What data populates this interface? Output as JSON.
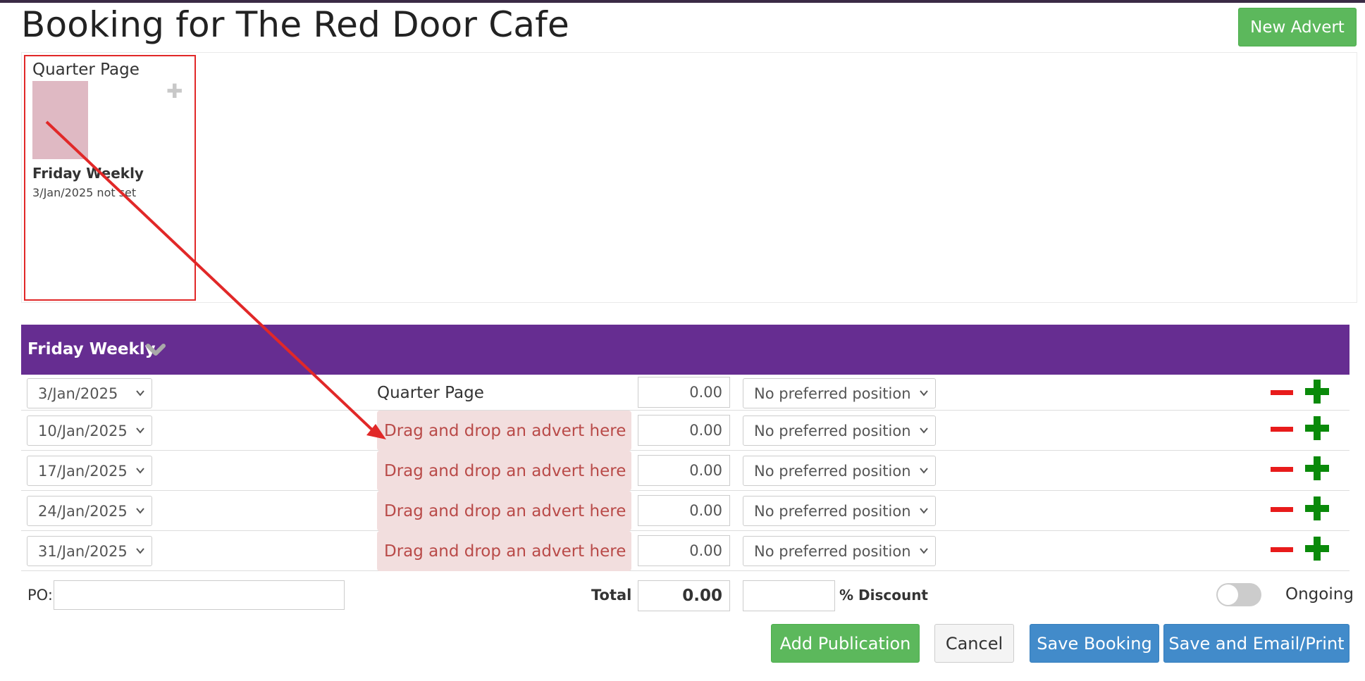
{
  "page": {
    "title": "Booking for The Red Door Cafe",
    "new_advert_label": "New Advert"
  },
  "advert_card": {
    "size": "Quarter Page",
    "publication": "Friday Weekly",
    "date_status": "3/Jan/2025 not set",
    "thumb_color": "#dfb9c3"
  },
  "publication": {
    "name": "Friday Weekly",
    "header_color": "#662d91",
    "rows": [
      {
        "date": "3/Jan/2025",
        "advert": "Quarter Page",
        "price": "0.00",
        "position": "No preferred position"
      },
      {
        "date": "10/Jan/2025",
        "advert": "Drag and drop an advert here",
        "price": "0.00",
        "position": "No preferred position"
      },
      {
        "date": "17/Jan/2025",
        "advert": "Drag and drop an advert here",
        "price": "0.00",
        "position": "No preferred position"
      },
      {
        "date": "24/Jan/2025",
        "advert": "Drag and drop an advert here",
        "price": "0.00",
        "position": "No preferred position"
      },
      {
        "date": "31/Jan/2025",
        "advert": "Drag and drop an advert here",
        "price": "0.00",
        "position": "No preferred position"
      }
    ]
  },
  "footer": {
    "po_label": "PO:",
    "total_label": "Total",
    "total_value": "0.00",
    "discount_label": "% Discount",
    "ongoing_label": "Ongoing"
  },
  "actions": {
    "add_publication": "Add Publication",
    "cancel": "Cancel",
    "save_booking": "Save Booking",
    "save_email_print": "Save and Email/Print"
  },
  "icons": {
    "remove": "minus-icon",
    "add": "plus-icon",
    "collapse": "chevron-down-icon"
  }
}
